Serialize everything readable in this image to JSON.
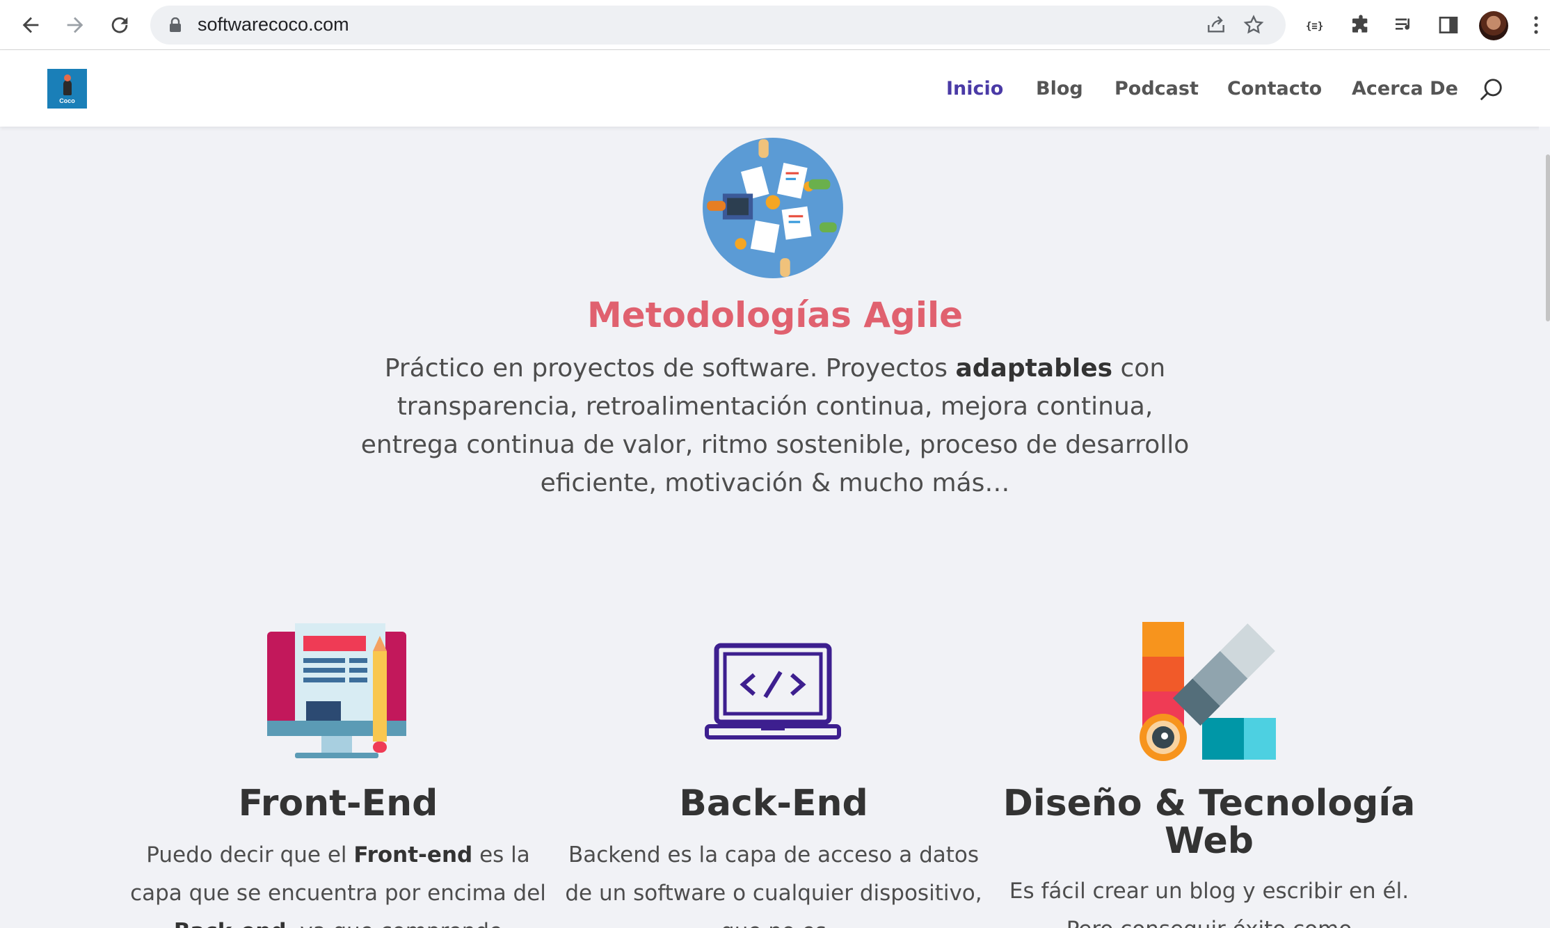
{
  "browser": {
    "url": "softwarecoco.com",
    "icons": [
      "back-icon",
      "forward-icon",
      "reload-icon",
      "lock-icon",
      "share-icon",
      "bookmark-star-icon",
      "dev-tools-icon",
      "extensions-icon",
      "media-control-icon",
      "side-panel-icon",
      "profile-avatar",
      "more-menu-icon"
    ]
  },
  "header": {
    "logo_text": "Coco",
    "nav": [
      "Inicio",
      "Blog",
      "Podcast",
      "Contacto",
      "Acerca De"
    ],
    "active": "Inicio"
  },
  "agile": {
    "title": "Metodologías Agile",
    "text_before": "Práctico en  proyectos de software. Proyectos ",
    "text_bold": "adaptables",
    "text_after": " con transparencia,  retroalimentación continua, mejora continua, entrega continua de valor, ritmo sostenible, proceso de desarrollo eficiente, motivación & mucho más…"
  },
  "cards": [
    {
      "title": "Front-End",
      "text_a": "Puedo decir que el ",
      "text_bold": "Front-end",
      "text_b": " es la capa que se encuentra por encima del ",
      "text_bold2": "Back-end",
      "text_c": ", ya que comprende"
    },
    {
      "title": "Back-End",
      "text": "Backend es la capa de acceso a datos de un software o cualquier dispositivo, que no es"
    },
    {
      "title": "Diseño & Tecnología Web",
      "text": "Es fácil crear un blog y escribir en él. Pero conseguir éxito como"
    }
  ],
  "colors": {
    "accent": "#4a3aa6",
    "agile_title": "#e0616f",
    "page_bg": "#f1f2f6"
  }
}
